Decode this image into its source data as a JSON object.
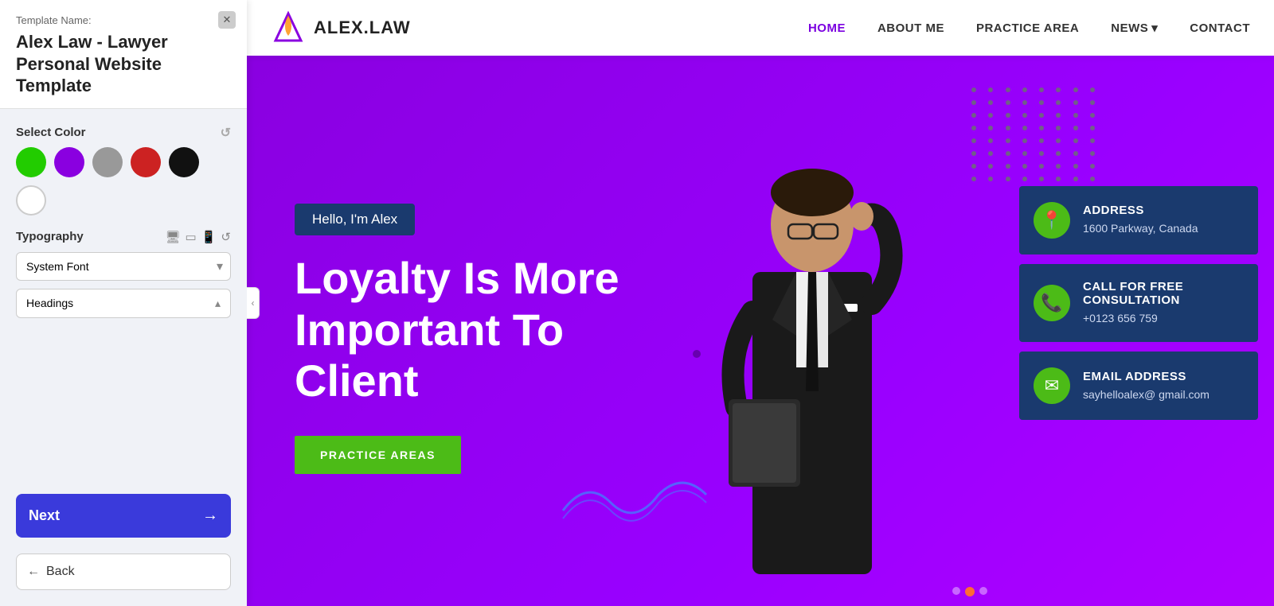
{
  "panel": {
    "template_label": "Template Name:",
    "template_title": "Alex Law - Lawyer Personal Website Template",
    "select_color_label": "Select Color",
    "colors": [
      {
        "name": "green",
        "hex": "#22cc00"
      },
      {
        "name": "purple",
        "hex": "#8a00e0"
      },
      {
        "name": "gray",
        "hex": "#999999"
      },
      {
        "name": "red",
        "hex": "#cc2222"
      },
      {
        "name": "black",
        "hex": "#111111"
      },
      {
        "name": "white",
        "hex": "#ffffff"
      }
    ],
    "typography_label": "Typography",
    "font_option": "System Font",
    "headings_label": "Headings",
    "next_label": "Next",
    "back_label": "Back"
  },
  "navbar": {
    "logo_text": "ALEX.LAW",
    "links": [
      {
        "label": "HOME",
        "active": true
      },
      {
        "label": "ABOUT ME",
        "active": false
      },
      {
        "label": "PRACTICE AREA",
        "active": false
      },
      {
        "label": "NEWS",
        "active": false,
        "has_dropdown": true
      },
      {
        "label": "CONTACT",
        "active": false
      }
    ]
  },
  "hero": {
    "hello_badge": "Hello, I'm Alex",
    "heading": "Loyalty Is More Important To Client",
    "practice_btn": "PRACTICE AREAS"
  },
  "info_cards": [
    {
      "icon": "📍",
      "title": "ADDRESS",
      "detail": "1600 Parkway, Canada"
    },
    {
      "icon": "📞",
      "title": "CALL FOR FREE CONSULTATION",
      "detail": "+0123 656 759"
    },
    {
      "icon": "✉",
      "title": "EMAIL ADDRESS",
      "detail": "sayhelloalex@ gmail.com"
    }
  ]
}
